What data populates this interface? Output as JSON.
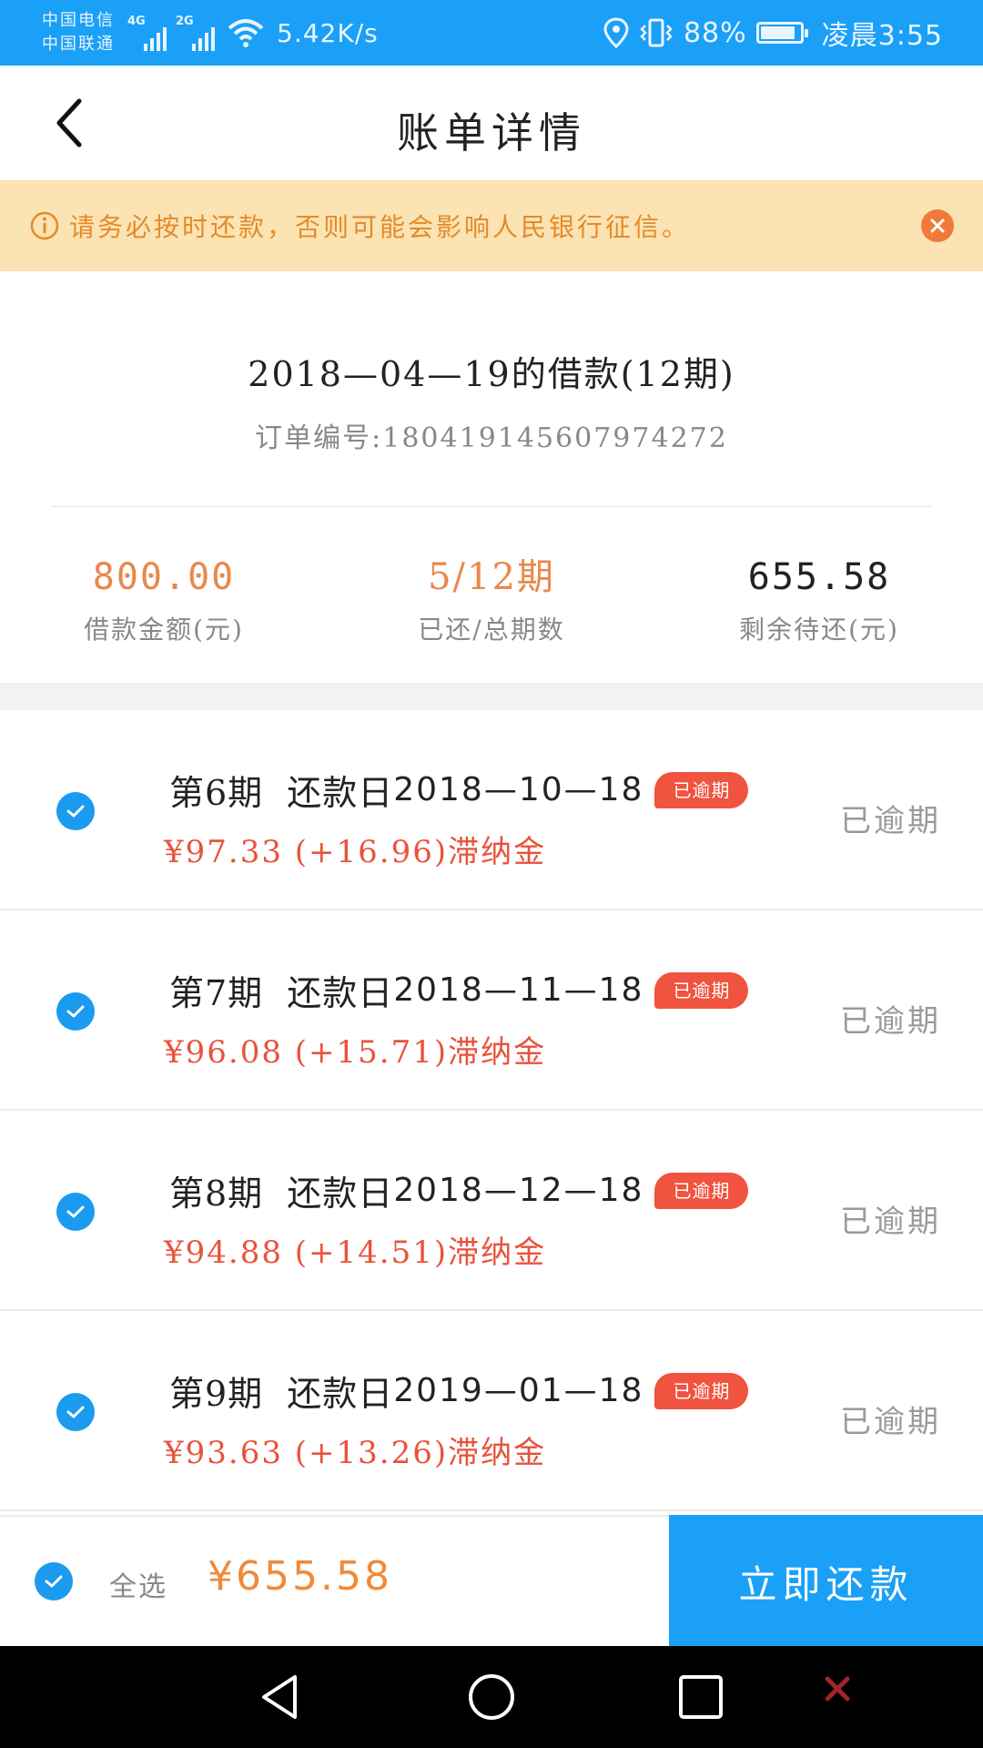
{
  "status_bar": {
    "carrier_1": "中国电信",
    "carrier_2": "中国联通",
    "network_1": "4G",
    "network_2": "2G",
    "speed": "5.42K/s",
    "battery": "88%",
    "time": "凌晨3:55",
    "icons": [
      "signal-icon",
      "wifi-icon",
      "location-icon",
      "vibrate-icon",
      "battery-icon"
    ]
  },
  "header": {
    "title": "账单详情"
  },
  "notice": {
    "text": "请务必按时还款，否则可能会影响人民银行征信。"
  },
  "loan": {
    "title": "2018—04—19的借款(12期)",
    "order_no": "订单编号:180419145607974272",
    "stats": [
      {
        "value": "800.00",
        "label": "借款金额(元)",
        "color": "#e8884a"
      },
      {
        "value": "5/12期",
        "label": "已还/总期数",
        "color": "#e8884a"
      },
      {
        "value": "655.58",
        "label": "剩余待还(元)",
        "color": "#222222"
      }
    ]
  },
  "installments": [
    {
      "period": "第6期",
      "due_label": "还款日",
      "due_date": "2018—10—18",
      "tag": "已逾期",
      "amount": "¥97.33 (+16.96)滞纳金",
      "status": "已逾期"
    },
    {
      "period": "第7期",
      "due_label": "还款日",
      "due_date": "2018—11—18",
      "tag": "已逾期",
      "amount": "¥96.08 (+15.71)滞纳金",
      "status": "已逾期"
    },
    {
      "period": "第8期",
      "due_label": "还款日",
      "due_date": "2018—12—18",
      "tag": "已逾期",
      "amount": "¥94.88 (+14.51)滞纳金",
      "status": "已逾期"
    },
    {
      "period": "第9期",
      "due_label": "还款日",
      "due_date": "2019—01—18",
      "tag": "已逾期",
      "amount": "¥93.63 (+13.26)滞纳金",
      "status": "已逾期"
    }
  ],
  "footer": {
    "select_all": "全选",
    "total": "¥655.58",
    "pay_button": "立即还款"
  },
  "colors": {
    "brand_blue": "#1aa0f6",
    "warning_bg": "#fbe3b3",
    "warning_text": "#e48a2a",
    "overdue_red": "#f0533f",
    "amount_orange": "#e8884a"
  }
}
